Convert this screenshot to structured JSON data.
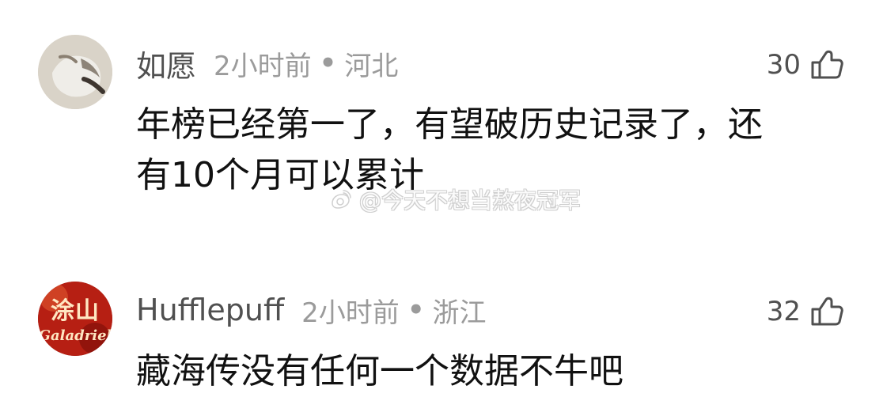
{
  "comments": [
    {
      "username": "如愿",
      "time": "2小时前",
      "separator": "•",
      "region": "河北",
      "likes": "30",
      "lines": [
        "年榜已经第一了，有望破历史记录了，还",
        "有10个月可以累计"
      ],
      "avatar_icon": "avatar-photo-icon"
    },
    {
      "username": "Hufflepuff",
      "time": "2小时前",
      "separator": "•",
      "region": "浙江",
      "likes": "32",
      "lines": [
        "藏海传没有任何一个数据不牛吧"
      ],
      "avatar_text_top": "涂山",
      "avatar_text_bottom": "Galadriel"
    }
  ],
  "watermark": {
    "handle": "@今天不想当熬夜冠军",
    "icon": "weibo-logo-icon"
  },
  "colors": {
    "username": "#505050",
    "meta": "#9b9b9b",
    "text": "#111111",
    "background": "#ffffff"
  }
}
